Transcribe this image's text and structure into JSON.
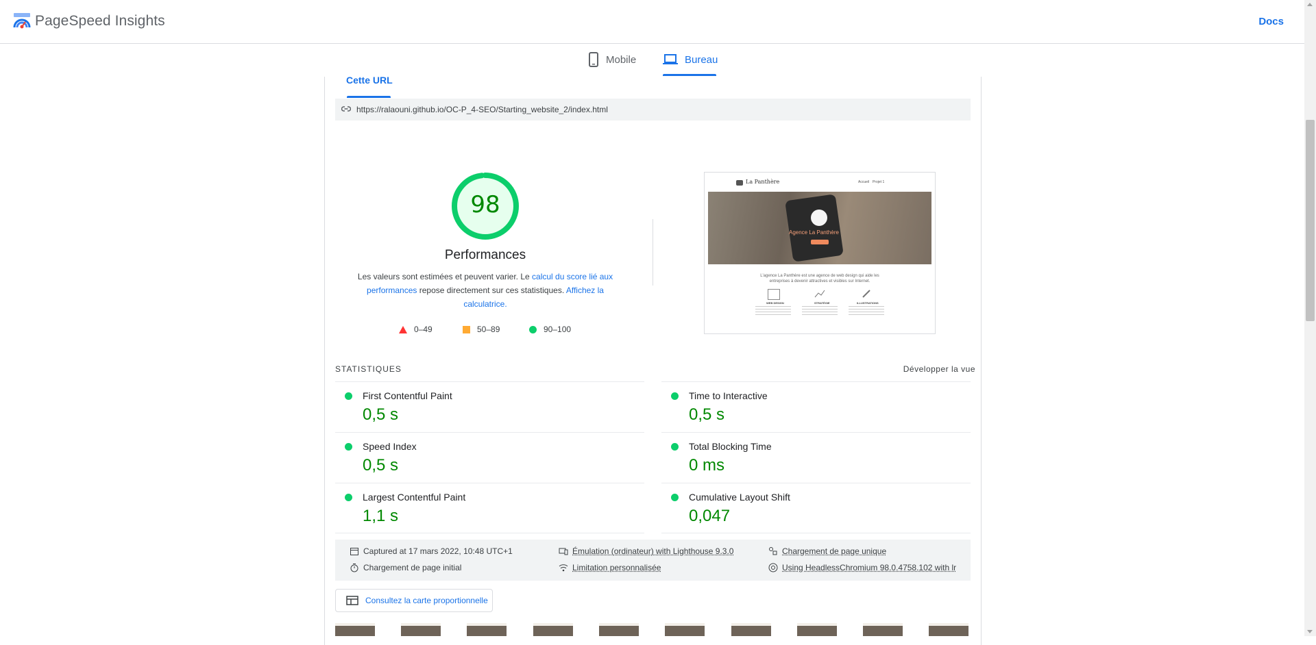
{
  "header": {
    "brand": "PageSpeed Insights",
    "docs_label": "Docs"
  },
  "device_tabs": {
    "mobile_label": "Mobile",
    "desktop_label": "Bureau",
    "active": "desktop"
  },
  "url_section": {
    "tab_label": "Cette URL",
    "url": "https://ralaouni.github.io/OC-P_4-SEO/Starting_website_2/index.html"
  },
  "score": {
    "value": "98",
    "fraction": 0.98,
    "title": "Performances",
    "desc_1": "Les valeurs sont estimées et peuvent varier. Le ",
    "desc_link1": "calcul du score lié aux performances",
    "desc_2": " repose directement sur ces statistiques. ",
    "desc_link2": "Affichez la calculatrice.",
    "legend": [
      {
        "label": "0–49",
        "shape": "triangle",
        "color": "#ff3333"
      },
      {
        "label": "50–89",
        "shape": "square",
        "color": "#ffaa33"
      },
      {
        "label": "90–100",
        "shape": "circle",
        "color": "#0cce6b"
      }
    ]
  },
  "screenshot_preview": {
    "site_title": "La Panthère",
    "nav_links": [
      "Accueil",
      "Projet 1"
    ],
    "hero_title": "Agence La Panthère",
    "intro": "L'agence La Panthère est une agence de web design qui aide les entreprises à devenir attractives et visibles sur Internet.",
    "features": [
      "WEB DESIGN",
      "STRATÉGIE",
      "ILLUSTRATIONS"
    ]
  },
  "stats": {
    "title": "STATISTIQUES",
    "expand_label": "Développer la vue",
    "metrics": [
      {
        "name": "First Contentful Paint",
        "value": "0,5 s",
        "status": "#0cce6b"
      },
      {
        "name": "Time to Interactive",
        "value": "0,5 s",
        "status": "#0cce6b"
      },
      {
        "name": "Speed Index",
        "value": "0,5 s",
        "status": "#0cce6b"
      },
      {
        "name": "Total Blocking Time",
        "value": "0 ms",
        "status": "#0cce6b"
      },
      {
        "name": "Largest Contentful Paint",
        "value": "1,1 s",
        "status": "#0cce6b"
      },
      {
        "name": "Cumulative Layout Shift",
        "value": "0,047",
        "status": "#0cce6b"
      }
    ]
  },
  "info": {
    "captured": "Captured at 17 mars 2022, 10:48 UTC+1",
    "initial_load": "Chargement de page initial",
    "emulation": "Émulation (ordinateur) with Lighthouse 9.3.0",
    "throttling": "Limitation personnalisée",
    "single_load": "Chargement de page unique",
    "browser": "Using HeadlessChromium 98.0.4758.102 with lr"
  },
  "treemap_button": "Consultez la carte proportionnelle",
  "colors": {
    "accent": "#1a73e8",
    "pass": "#0cce6b",
    "pass_text": "#008800"
  }
}
